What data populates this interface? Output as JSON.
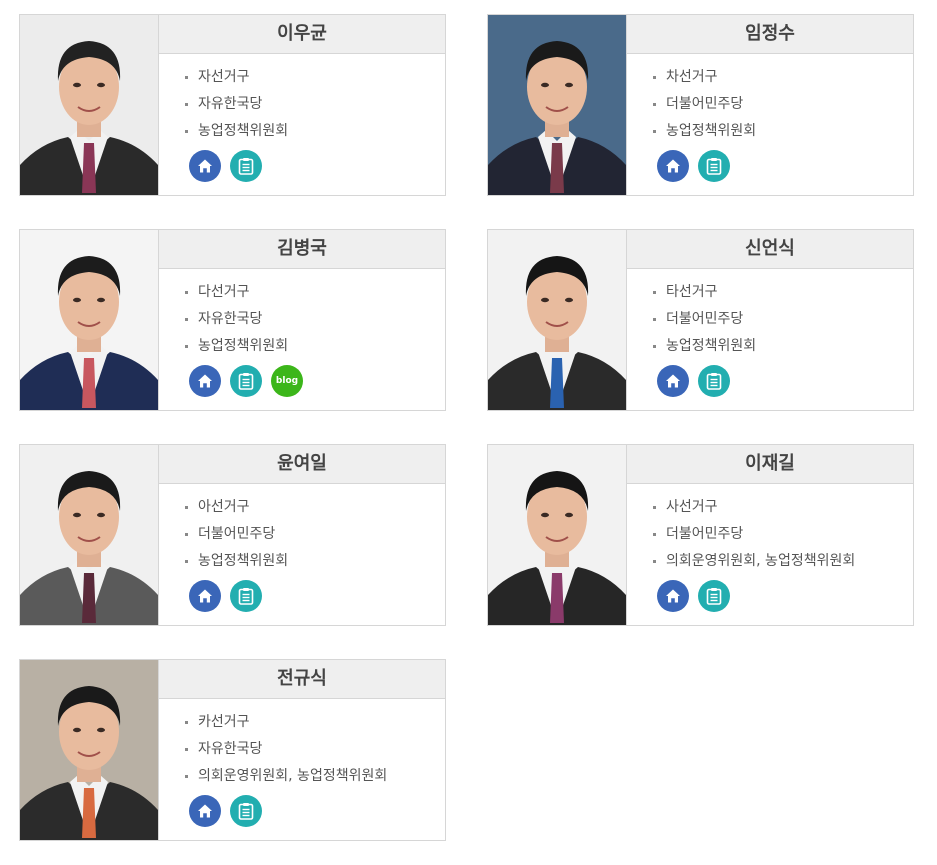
{
  "members": [
    {
      "name": "이우균",
      "district": "자선거구",
      "party": "자유한국당",
      "committee": "농업정책위원회",
      "bg": "#ececec",
      "suit": "#2a2a2a",
      "tie": "#8a3656",
      "hair": "#222222"
    },
    {
      "name": "임정수",
      "district": "차선거구",
      "party": "더불어민주당",
      "committee": "농업정책위원회",
      "bg": "#4a6a8a",
      "suit": "#222533",
      "tie": "#7a3a4a",
      "hair": "#1a1a1a"
    },
    {
      "name": "김병국",
      "district": "다선거구",
      "party": "자유한국당",
      "committee": "농업정책위원회",
      "blog": "blog",
      "bg": "#f4f4f4",
      "suit": "#1f2d55",
      "tie": "#c8575f",
      "hair": "#1c1c1c"
    },
    {
      "name": "신언식",
      "district": "타선거구",
      "party": "더불어민주당",
      "committee": "농업정책위원회",
      "bg": "#f2f2f2",
      "suit": "#2a2a2a",
      "tie": "#2a62b0",
      "hair": "#151515"
    },
    {
      "name": "윤여일",
      "district": "아선거구",
      "party": "더불어민주당",
      "committee": "농업정책위원회",
      "bg": "#f0f0f0",
      "suit": "#5a5a5a",
      "tie": "#5a2a3a",
      "hair": "#1a1a1a"
    },
    {
      "name": "이재길",
      "district": "사선거구",
      "party": "더불어민주당",
      "committee": "의회운영위원회, 농업정책위원회",
      "bg": "#f2f2f2",
      "suit": "#262626",
      "tie": "#8a3a6a",
      "hair": "#151515"
    },
    {
      "name": "전규식",
      "district": "카선거구",
      "party": "자유한국당",
      "committee": "의회운영위원회, 농업정책위원회",
      "bg": "#b8b0a4",
      "suit": "#2b2b2b",
      "tie": "#d86a40",
      "hair": "#1a1a1a"
    }
  ],
  "icons": {
    "home": "home-icon",
    "doc": "clipboard-icon",
    "blog": "blog-icon"
  },
  "colors": {
    "home": "#3a66b8",
    "doc": "#22aeb0",
    "blog": "#3cb61a"
  }
}
